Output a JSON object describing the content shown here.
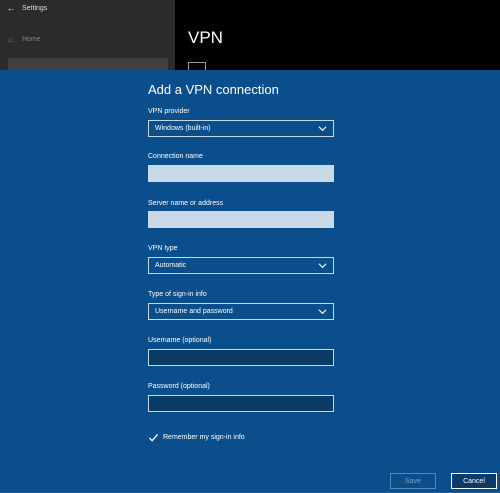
{
  "background": {
    "window_title": "Settings",
    "back_icon": "←",
    "home_label": "Home",
    "home_icon": "⌂",
    "page_title": "VPN",
    "add_vpn_label": "Add a VPN connection"
  },
  "dialog": {
    "title": "Add a VPN connection",
    "vpn_provider": {
      "label": "VPN provider",
      "value": "Windows (built-in)"
    },
    "connection_name": {
      "label": "Connection name",
      "value": ""
    },
    "server": {
      "label": "Server name or address",
      "value": ""
    },
    "vpn_type": {
      "label": "VPN type",
      "value": "Automatic"
    },
    "signin_type": {
      "label": "Type of sign-in info",
      "value": "Username and password"
    },
    "username": {
      "label": "Username (optional)",
      "value": ""
    },
    "password": {
      "label": "Password (optional)",
      "value": ""
    },
    "remember": {
      "label": "Remember my sign-in info",
      "checked": true
    },
    "save_label": "Save",
    "cancel_label": "Cancel"
  },
  "colors": {
    "dialog_bg": "#0b4e8c",
    "field_light": "#c9d9e8",
    "field_dark": "#0a3a66"
  }
}
